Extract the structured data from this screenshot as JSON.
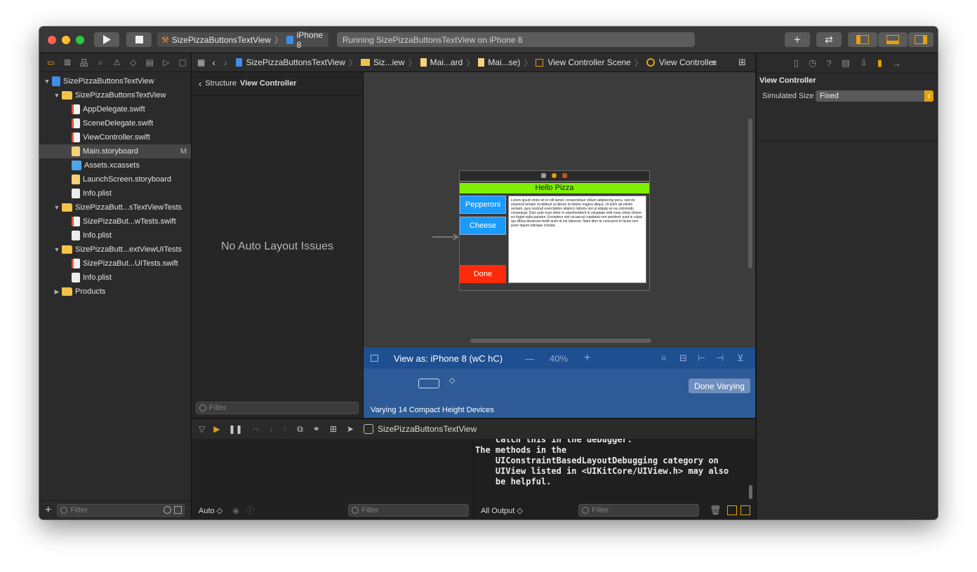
{
  "toolbar": {
    "scheme_name": "SizePizzaButtonsTextView",
    "device_name": "iPhone 8",
    "status_text": "Running SizePizzaButtonsTextView on iPhone 8",
    "play_icon": "play-icon",
    "stop_icon": "stop-icon",
    "traffic_light_colors": [
      "#fe5f57",
      "#febc2e",
      "#28c840"
    ]
  },
  "navigator": {
    "tabs": [
      "folder-icon",
      "source-control-icon",
      "symbol-icon",
      "find-icon",
      "issue-icon",
      "test-icon",
      "debug-icon",
      "breakpoint-icon",
      "report-icon"
    ],
    "items": [
      {
        "label": "SizePizzaButtonsTextView",
        "icon": "proj",
        "indent": 0,
        "expanded": true,
        "badge": ""
      },
      {
        "label": "SizePizzaButtonsTextView",
        "icon": "folder",
        "indent": 1,
        "expanded": true,
        "badge": ""
      },
      {
        "label": "AppDelegate.swift",
        "icon": "swift",
        "indent": 2,
        "badge": ""
      },
      {
        "label": "SceneDelegate.swift",
        "icon": "swift",
        "indent": 2,
        "badge": ""
      },
      {
        "label": "ViewController.swift",
        "icon": "swift",
        "indent": 2,
        "badge": ""
      },
      {
        "label": "Main.storyboard",
        "icon": "sb",
        "indent": 2,
        "badge": "M",
        "selected": true
      },
      {
        "label": "Assets.xcassets",
        "icon": "assets",
        "indent": 2,
        "badge": ""
      },
      {
        "label": "LaunchScreen.storyboard",
        "icon": "sb",
        "indent": 2,
        "badge": ""
      },
      {
        "label": "Info.plist",
        "icon": "plist",
        "indent": 2,
        "badge": ""
      },
      {
        "label": "SizePizzaButt...sTextViewTests",
        "icon": "folder",
        "indent": 1,
        "expanded": true,
        "badge": ""
      },
      {
        "label": "SizePizzaBut...wTests.swift",
        "icon": "swift",
        "indent": 2,
        "badge": ""
      },
      {
        "label": "Info.plist",
        "icon": "plist",
        "indent": 2,
        "badge": ""
      },
      {
        "label": "SizePizzaButt...extViewUITests",
        "icon": "folder",
        "indent": 1,
        "expanded": true,
        "badge": ""
      },
      {
        "label": "SizePizzaBut...UITests.swift",
        "icon": "swift",
        "indent": 2,
        "badge": ""
      },
      {
        "label": "Info.plist",
        "icon": "plist",
        "indent": 2,
        "badge": ""
      },
      {
        "label": "Products",
        "icon": "folder",
        "indent": 1,
        "expanded": false,
        "badge": ""
      }
    ],
    "filter_placeholder": "Filter"
  },
  "jumpbar": {
    "crumbs": [
      "SizePizzaButtonsTextView",
      "Siz...iew",
      "Mai...ard",
      "Mai...se)",
      "View Controller Scene",
      "View Controller"
    ]
  },
  "outline": {
    "back_label": "Structure",
    "title": "View Controller",
    "empty_message": "No Auto Layout Issues",
    "filter_placeholder": "Filter"
  },
  "storyboard": {
    "title_label": "Hello Pizza",
    "buttons": [
      "Pepperoni",
      "Cheese",
      "Done"
    ],
    "button_colors": [
      "#1a9bfc",
      "#1a9bfc",
      "#ff2a0a"
    ],
    "title_color": "#7ff000",
    "text_view_body": "Lorem ipsum dolor sit er elit lamet, consectetaur cillium adipisicing pecu, sed do eiusmod tempor incididunt ut labore et dolore magna aliqua. Ut enim ad minim veniam, quis nostrud exercitation ullamco laboris nisi ut aliquip ex ea commodo consequat. Duis aute irure dolor in reprehenderit in voluptate velit esse cillum dolore eu fugiat nulla pariatur. Excepteur sint occaecat cupidatat non proident, sunt in culpa qui officia deserunt mollit anim id est laborum. Nam liber te conscient to factor tum poen legum odioque civiuda."
  },
  "view_as": {
    "label": "View as: iPhone 8 (wC hC)",
    "zoom": "40%",
    "minus": "—",
    "plus": "+",
    "varying_text": "Varying 14 Compact Height Devices",
    "done_button": "Done Varying"
  },
  "debug": {
    "target_name": "SizePizzaButtonsTextView",
    "scope_selector": "Auto ◇",
    "output_selector": "All Output ◇",
    "filter_placeholder": "Filter",
    "console_lines": [
      "    catch this in the debugger.",
      "The methods in the",
      "    UIConstraintBasedLayoutDebugging category on",
      "    UIView listed in <UIKitCore/UIView.h> may also",
      "    be helpful."
    ]
  },
  "inspector": {
    "tabs": [
      "file-icon",
      "history-icon",
      "help-icon",
      "identity-icon",
      "attributes-icon",
      "size-icon",
      "connections-icon"
    ],
    "section_title": "View Controller",
    "simulated_size_label": "Simulated Size",
    "simulated_size_value": "Fixed",
    "accent_color": "#e3a10d"
  }
}
